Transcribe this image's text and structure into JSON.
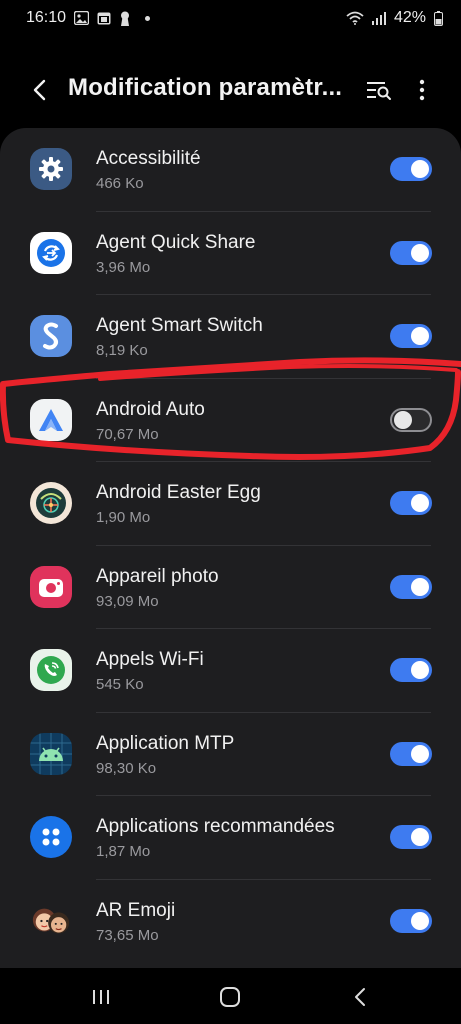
{
  "status": {
    "time": "16:10",
    "battery": "42%"
  },
  "header": {
    "title": "Modification paramètr..."
  },
  "apps": [
    {
      "name": "Accessibilité",
      "size": "466 Ko",
      "enabled": true,
      "icon": "gear-icon"
    },
    {
      "name": "Agent Quick Share",
      "size": "3,96 Mo",
      "enabled": true,
      "icon": "quick-share-icon"
    },
    {
      "name": "Agent Smart Switch",
      "size": "8,19 Ko",
      "enabled": true,
      "icon": "smart-switch-icon"
    },
    {
      "name": "Android Auto",
      "size": "70,67 Mo",
      "enabled": false,
      "icon": "android-auto-icon"
    },
    {
      "name": "Android Easter Egg",
      "size": "1,90 Mo",
      "enabled": true,
      "icon": "easter-egg-icon"
    },
    {
      "name": "Appareil photo",
      "size": "93,09 Mo",
      "enabled": true,
      "icon": "camera-icon"
    },
    {
      "name": "Appels Wi-Fi",
      "size": "545 Ko",
      "enabled": true,
      "icon": "wifi-call-icon"
    },
    {
      "name": "Application MTP",
      "size": "98,30 Ko",
      "enabled": true,
      "icon": "android-robot-icon"
    },
    {
      "name": "Applications recommandées",
      "size": "1,87 Mo",
      "enabled": true,
      "icon": "recommended-apps-icon"
    },
    {
      "name": "AR Emoji",
      "size": "73,65 Mo",
      "enabled": true,
      "icon": "ar-emoji-icon"
    }
  ],
  "colors": {
    "toggle_on": "#3e7bf0",
    "highlight": "#e8232a",
    "card": "#1e1e20"
  }
}
